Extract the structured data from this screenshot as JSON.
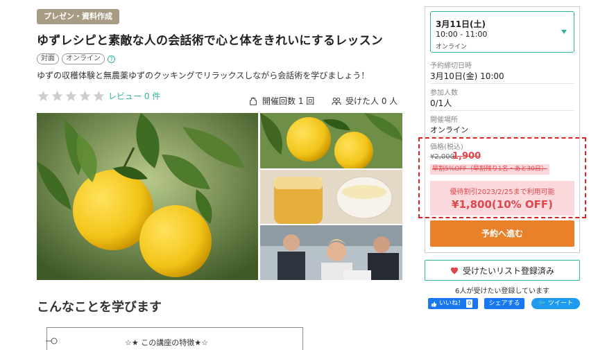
{
  "header": {
    "category": "プレゼン・資料作成",
    "title": "ゆずレシピと素敵な人の会話術で心と体をきれいにするレッスン",
    "tags": [
      "対面",
      "オンライン"
    ],
    "subtitle": "ゆずの収穫体験と無農薬ゆずのクッキングでリラックスしながら会話術を学びましょう！"
  },
  "rating": {
    "stars": 0,
    "max_stars": 5,
    "review_label": "レビュー 0 件"
  },
  "stats": {
    "held": "開催回数 1 回",
    "received": "受けた人 0 人"
  },
  "gallery": {
    "main": "yuzu-fruit-photo",
    "thumbs": [
      "yuzu-fruit-photo",
      "yuzu-jam-and-drink-photo",
      "business-people-meeting-photo"
    ]
  },
  "content": {
    "section_heading": "こんなことを学びます",
    "features_title": "☆★ この講座の特徴★☆"
  },
  "booking": {
    "date": {
      "day": "3月11日(土)",
      "time": "10:00 - 11:00",
      "mode": "オンライン"
    },
    "deadline_label": "予約締切日時",
    "deadline_value": "3月10日(金) 10:00",
    "participants_label": "参加人数",
    "participants_value": "0/1人",
    "venue_label": "開催場所",
    "venue_value": "オンライン",
    "price_label": "価格(税込)",
    "price_original": "¥2,000",
    "price_early": "1,900",
    "early_note": "早割5%OFF（早割残り1名・あと30日）",
    "discount_note": "優待割引2023/2/25まで利用可能",
    "discount_price": "¥1,800(10% OFF)",
    "reserve_label": "予約へ進む"
  },
  "social": {
    "wishlist_label": "受けたいリスト登録済み",
    "wishlist_count": "6人が受けたい登録しています",
    "like_label": "いいね！",
    "like_count": "0",
    "share_label": "シェアする",
    "tweet_label": "ツイート"
  },
  "colors": {
    "accent": "#2bb39a",
    "category_badge": "#a99c85",
    "discount_red": "#e0474c",
    "reserve_orange": "#e8812a",
    "highlight_dash": "#e02020"
  }
}
